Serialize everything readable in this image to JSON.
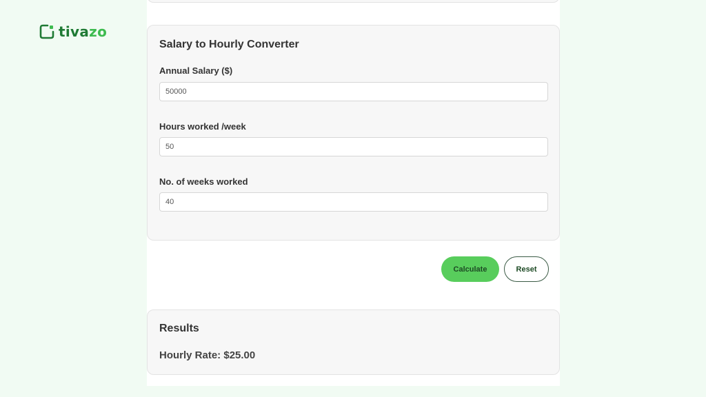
{
  "brand": {
    "name_prefix": "tiva",
    "name_suffix": "zo",
    "icon": "logo-bracket-icon",
    "color": "#1f7a34",
    "accent": "#3dbb4f"
  },
  "converter": {
    "title": "Salary to Hourly Converter",
    "fields": [
      {
        "label": "Annual Salary ($)",
        "value": "50000"
      },
      {
        "label": "Hours worked /week",
        "value": "50"
      },
      {
        "label": "No. of weeks worked",
        "value": "40"
      }
    ]
  },
  "actions": {
    "calculate_label": "Calculate",
    "reset_label": "Reset",
    "calculate_color": "#58cd5c"
  },
  "results": {
    "title": "Results",
    "hourly_rate": "Hourly Rate: $25.00"
  }
}
